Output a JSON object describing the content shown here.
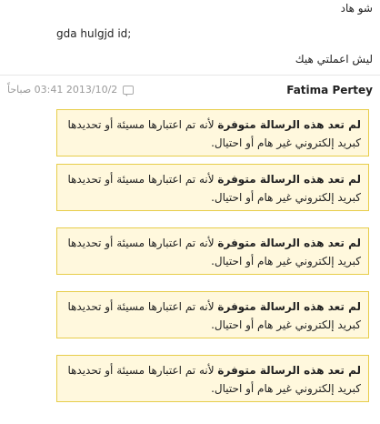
{
  "messages": [
    {
      "text": "شو هاد"
    },
    {
      "text": "gda hulgjd id;"
    },
    {
      "text": "ليش اعملتي هيك"
    }
  ],
  "post": {
    "author": "Fatima Pertey",
    "timestamp": "2013/10/2 03:41 صباحاً",
    "icon": "comment-icon"
  },
  "notices": [
    {
      "bold": "لم تعد هذه الرسالة متوفرة",
      "text": " لأنه تم اعتبارها مسيئة أو تحديدها كبريد إلكتروني غير هام أو احتيال."
    },
    {
      "bold": "لم تعد هذه الرسالة متوفرة",
      "text": " لأنه تم اعتبارها مسيئة أو تحديدها كبريد إلكتروني غير هام أو احتيال."
    },
    {
      "bold": "لم تعد هذه الرسالة متوفرة",
      "text": " لأنه تم اعتبارها مسيئة أو تحديدها كبريد إلكتروني غير هام أو احتيال."
    },
    {
      "bold": "لم تعد هذه الرسالة متوفرة",
      "text": " لأنه تم اعتبارها مسيئة أو تحديدها كبريد إلكتروني غير هام أو احتيال."
    },
    {
      "bold": "لم تعد هذه الرسالة متوفرة",
      "text": " لأنه تم اعتبارها مسيئة أو تحديدها كبريد إلكتروني غير هام أو احتيال."
    }
  ],
  "colors": {
    "notice_bg": "#fff8dd",
    "notice_border": "#e7cd4a",
    "meta_text": "#9a9a9a"
  }
}
